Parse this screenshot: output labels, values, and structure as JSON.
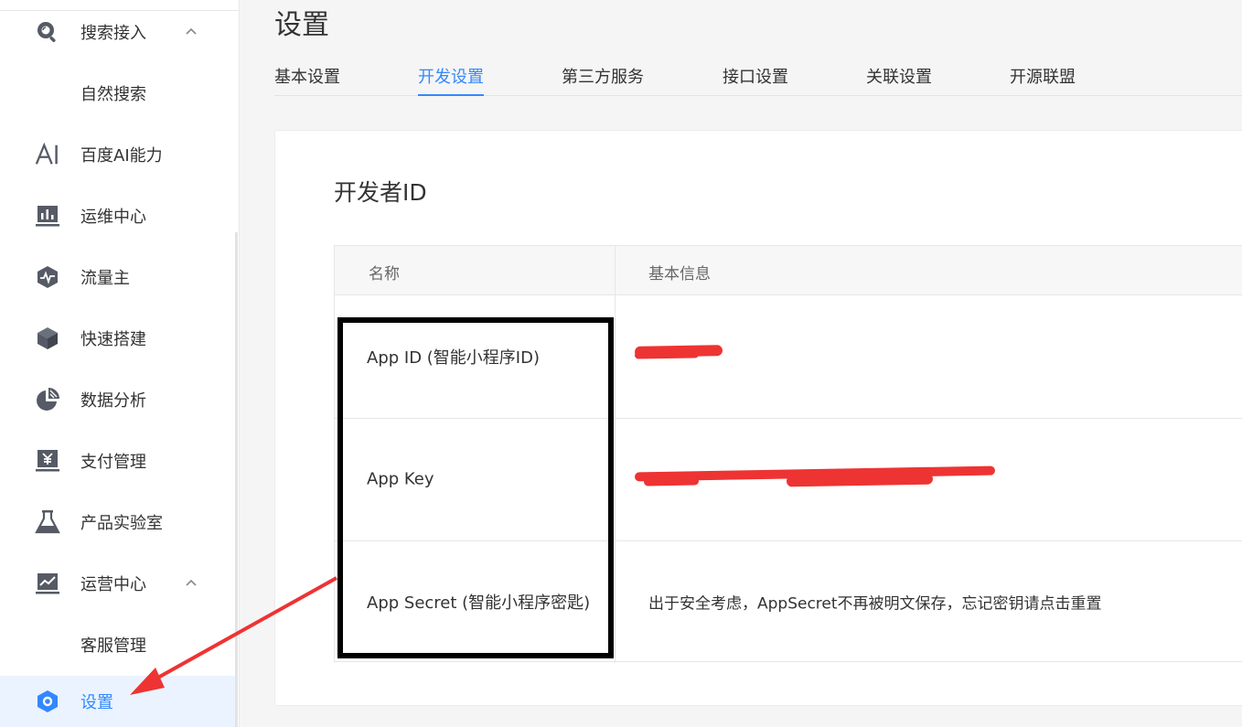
{
  "sidebar": {
    "items": [
      {
        "label": "搜索接入",
        "icon": "search-icon",
        "expanded": true
      },
      {
        "label": "自然搜索",
        "sub": true
      },
      {
        "label": "百度AI能力",
        "icon": "ai-icon"
      },
      {
        "label": "运维中心",
        "icon": "bar-chart-icon"
      },
      {
        "label": "流量主",
        "icon": "pulse-hexagon-icon"
      },
      {
        "label": "快速搭建",
        "icon": "cube-icon"
      },
      {
        "label": "数据分析",
        "icon": "pie-chart-icon"
      },
      {
        "label": "支付管理",
        "icon": "yuan-icon"
      },
      {
        "label": "产品实验室",
        "icon": "flask-icon"
      },
      {
        "label": "运营中心",
        "icon": "line-chart-icon",
        "expanded": true
      },
      {
        "label": "客服管理",
        "sub": true
      },
      {
        "label": "设置",
        "icon": "settings-hexagon-icon",
        "active": true
      }
    ]
  },
  "header": {
    "title": "设置"
  },
  "tabs": [
    {
      "label": "基本设置"
    },
    {
      "label": "开发设置",
      "active": true
    },
    {
      "label": "第三方服务"
    },
    {
      "label": "接口设置"
    },
    {
      "label": "关联设置"
    },
    {
      "label": "开源联盟"
    }
  ],
  "card": {
    "title": "开发者ID",
    "table": {
      "headers": [
        "名称",
        "基本信息"
      ],
      "rows": [
        {
          "name": "App ID (智能小程序ID)",
          "info": ""
        },
        {
          "name": "App Key",
          "info": ""
        },
        {
          "name": "App Secret (智能小程序密匙)",
          "info": "出于安全考虑，AppSecret不再被明文保存，忘记密钥请点击重置"
        }
      ]
    }
  },
  "colors": {
    "accent": "#3388ff",
    "active_bg": "#eaf3ff",
    "redact": "#ee3333",
    "arrow": "#ee3333",
    "icon": "#555a66"
  }
}
